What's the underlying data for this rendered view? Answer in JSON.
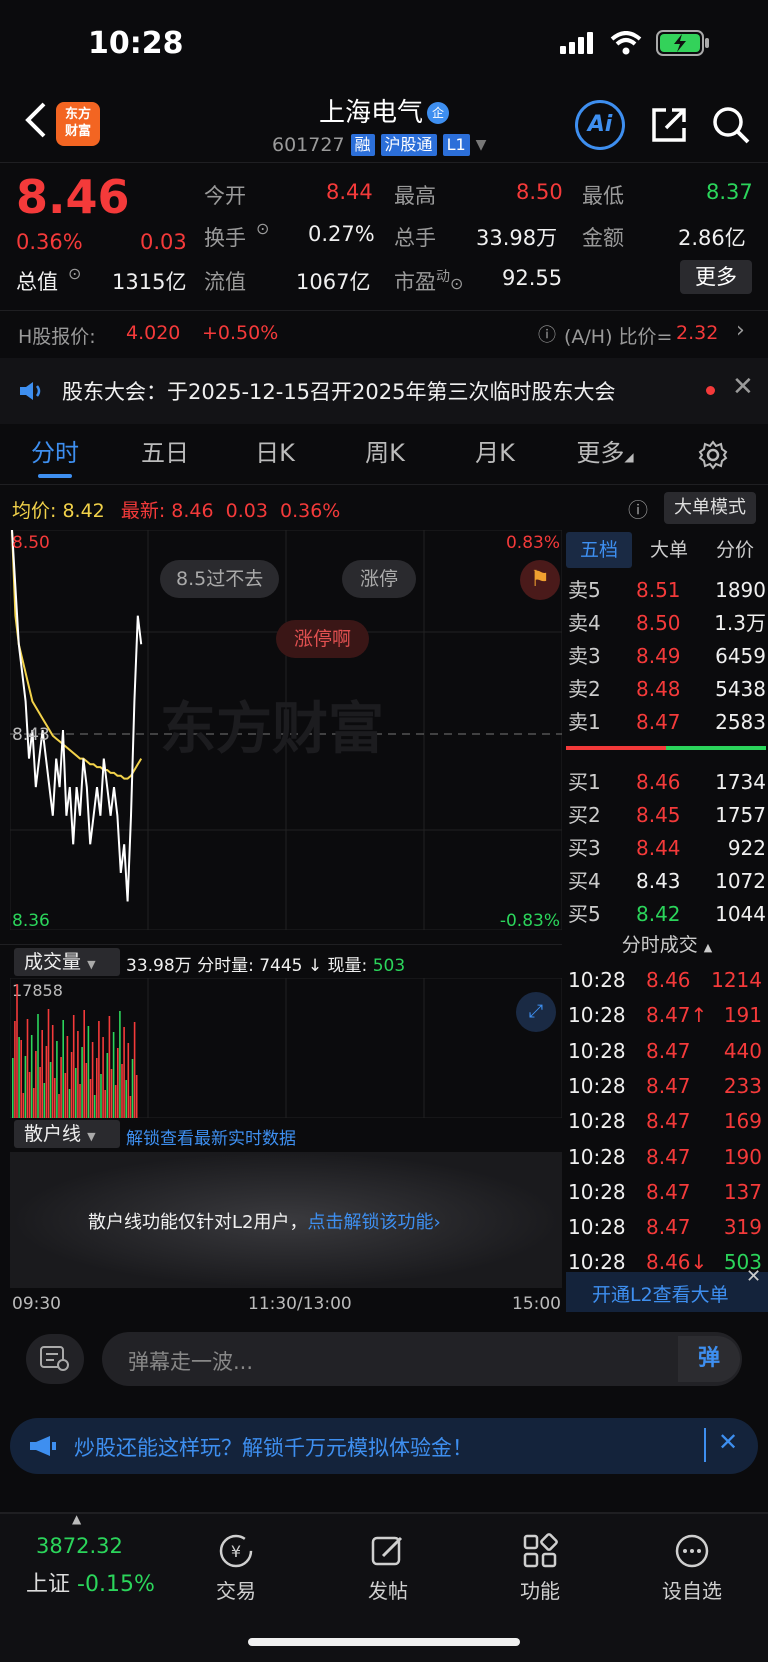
{
  "status": {
    "time": "10:28"
  },
  "header": {
    "logo_line1": "东方",
    "logo_line2": "财富",
    "stock_name": "上海电气",
    "name_tag": "企",
    "code": "601727",
    "badges": [
      "融",
      "沪股通",
      "L1"
    ],
    "ai_label": "Ai"
  },
  "quote": {
    "price": "8.46",
    "change_pct": "0.36%",
    "change": "0.03",
    "open_label": "今开",
    "open": "8.44",
    "high_label": "最高",
    "high": "8.50",
    "low_label": "最低",
    "low": "8.37",
    "turnover_label": "换手",
    "turnover": "0.27%",
    "volume_label": "总手",
    "volume": "33.98万",
    "amount_label": "金额",
    "amount": "2.86亿",
    "mktcap_label": "总值",
    "mktcap": "1315亿",
    "float_label": "流值",
    "float": "1067亿",
    "pe_label": "市盈",
    "pe_sup": "动",
    "pe": "92.55",
    "more": "更多"
  },
  "hshare": {
    "label": "H股报价:",
    "price": "4.020",
    "change": "+0.50%",
    "ah_label": "(A/H) 比价=",
    "ah_value": "2.32"
  },
  "notice": {
    "text": "股东大会：于2025-12-15召开2025年第三次临时股东大会"
  },
  "tabs": [
    "分时",
    "五日",
    "日K",
    "周K",
    "月K",
    "更多"
  ],
  "chart_header": {
    "avg_label": "均价:",
    "avg": "8.42",
    "latest_label": "最新:",
    "latest": "8.46",
    "change": "0.03",
    "pct": "0.36%",
    "mode_btn": "大单模式"
  },
  "chart_labels": {
    "y_top": "8.50",
    "y_mid": "8.43",
    "y_bottom": "8.36",
    "pct_top": "0.83%",
    "pct_bottom": "-0.83%",
    "bubble1": "8.5过不去",
    "bubble2": "涨停",
    "bubble3": "涨停啊",
    "watermark": "东方财富"
  },
  "chart_data": {
    "type": "line",
    "title": "",
    "ylim": [
      8.36,
      8.5
    ],
    "series": [
      {
        "values": [
          8.5,
          8.48,
          8.46,
          8.45,
          8.44,
          8.42,
          8.43,
          8.41,
          8.42,
          8.43,
          8.42,
          8.41,
          8.4,
          8.42,
          8.41,
          8.43,
          8.4,
          8.41,
          8.39,
          8.41,
          8.4,
          8.42,
          8.41,
          8.39,
          8.4,
          8.41,
          8.4,
          8.42,
          8.41,
          8.4,
          8.41,
          8.4,
          8.38,
          8.39,
          8.37,
          8.4,
          8.44,
          8.47,
          8.46
        ]
      },
      {
        "values": [
          8.5,
          8.47,
          8.46,
          8.455,
          8.45,
          8.445,
          8.44,
          8.438,
          8.436,
          8.434,
          8.432,
          8.43,
          8.428,
          8.427,
          8.426,
          8.425,
          8.424,
          8.423,
          8.422,
          8.421,
          8.42,
          8.42,
          8.419,
          8.418,
          8.418,
          8.417,
          8.417,
          8.416,
          8.416,
          8.415,
          8.415,
          8.414,
          8.414,
          8.413,
          8.413,
          8.414,
          8.416,
          8.418,
          8.42
        ]
      }
    ]
  },
  "order_book": {
    "tabs": [
      "五档",
      "大单",
      "分价"
    ],
    "asks": [
      {
        "label": "卖5",
        "price": "8.51",
        "vol": "1890"
      },
      {
        "label": "卖4",
        "price": "8.50",
        "vol": "1.3万"
      },
      {
        "label": "卖3",
        "price": "8.49",
        "vol": "6459"
      },
      {
        "label": "卖2",
        "price": "8.48",
        "vol": "5438"
      },
      {
        "label": "卖1",
        "price": "8.47",
        "vol": "2583"
      }
    ],
    "bids": [
      {
        "label": "买1",
        "price": "8.46",
        "vol": "1734"
      },
      {
        "label": "买2",
        "price": "8.45",
        "vol": "1757"
      },
      {
        "label": "买3",
        "price": "8.44",
        "vol": "922"
      },
      {
        "label": "买4",
        "price": "8.43",
        "vol": "1072"
      },
      {
        "label": "买5",
        "price": "8.42",
        "vol": "1044"
      }
    ]
  },
  "ticks": {
    "title": "分时成交",
    "rows": [
      {
        "t": "10:28",
        "p": "8.46",
        "v": "1214"
      },
      {
        "t": "10:28",
        "p": "8.47↑",
        "v": "191"
      },
      {
        "t": "10:28",
        "p": "8.47",
        "v": "440"
      },
      {
        "t": "10:28",
        "p": "8.47",
        "v": "233"
      },
      {
        "t": "10:28",
        "p": "8.47",
        "v": "169"
      },
      {
        "t": "10:28",
        "p": "8.47",
        "v": "190"
      },
      {
        "t": "10:28",
        "p": "8.47",
        "v": "137"
      },
      {
        "t": "10:28",
        "p": "8.47",
        "v": "319"
      },
      {
        "t": "10:28",
        "p": "8.46↓",
        "v": "503"
      }
    ],
    "l2_btn": "开通L2查看大单"
  },
  "volume": {
    "selector": "成交量",
    "total": "33.98万",
    "fen_label": "分时量:",
    "fen": "7445",
    "now_label": "现量:",
    "now": "503",
    "max": "17858"
  },
  "retail": {
    "selector": "散户线",
    "unlock_link": "解锁查看最新实时数据",
    "msg": "散户线功能仅针对L2用户，",
    "msg_link": "点击解锁该功能"
  },
  "time_axis": {
    "start": "09:30",
    "mid": "11:30/13:00",
    "end": "15:00"
  },
  "danmu": {
    "placeholder": "弹幕走一波...",
    "btn": "弹"
  },
  "promo": {
    "text": "炒股还能这样玩？解锁千万元模拟体验金！"
  },
  "nav": {
    "index_value": "3872.32",
    "index_name": "上证",
    "index_change": "-0.15%",
    "items": [
      "交易",
      "发帖",
      "功能",
      "设自选"
    ]
  }
}
